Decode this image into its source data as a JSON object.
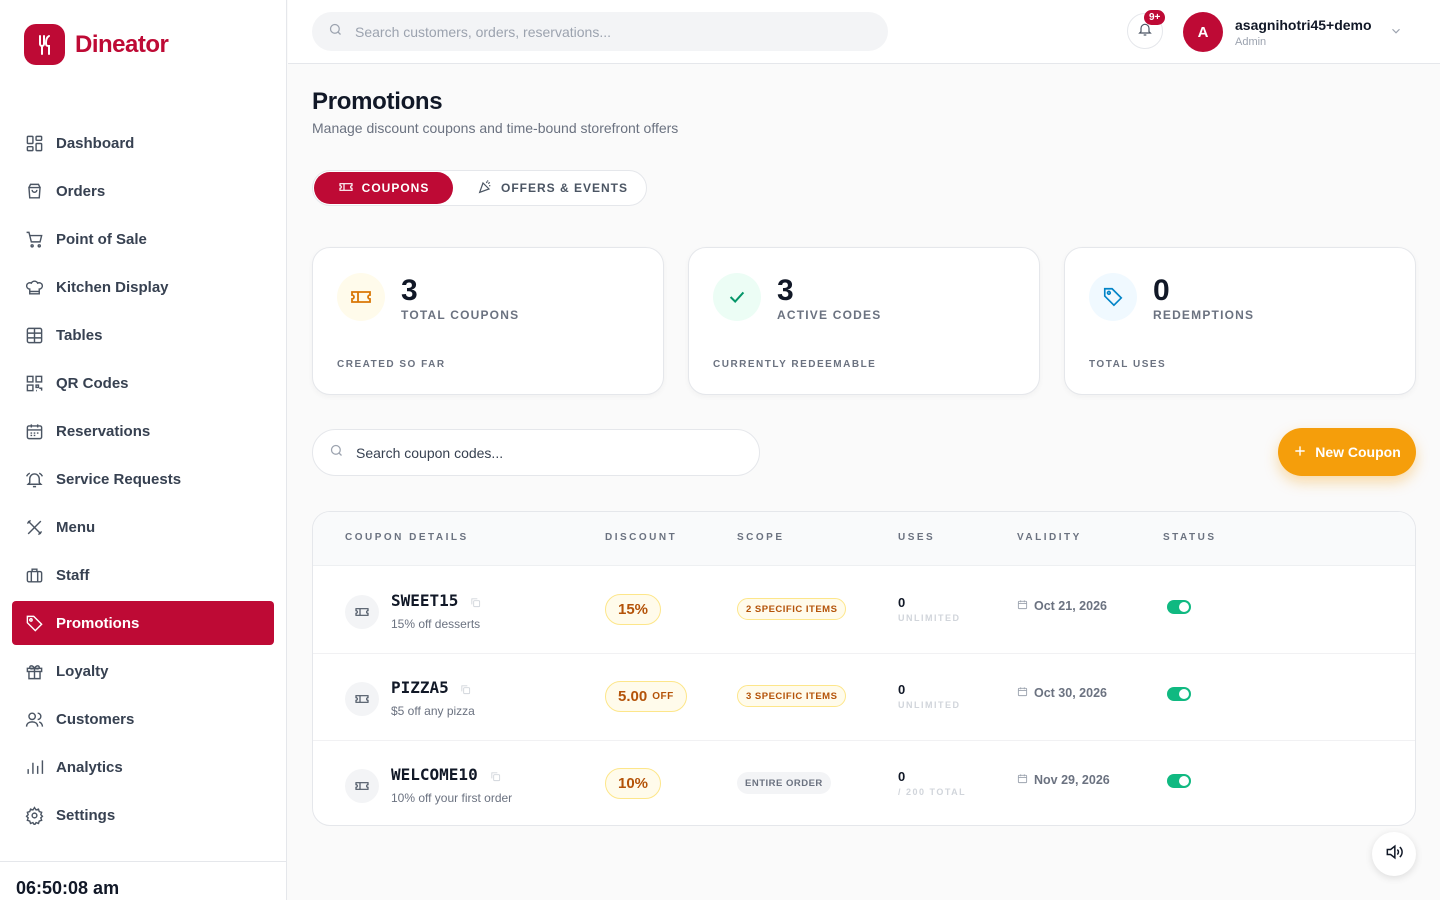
{
  "brand": {
    "name": "Dineator",
    "accent": "#be0a35",
    "orange": "#f59e0b",
    "green": "#10b981"
  },
  "sidebar": {
    "items": [
      {
        "label": "Dashboard",
        "icon": "dashboard-icon"
      },
      {
        "label": "Orders",
        "icon": "shopping-bag-icon"
      },
      {
        "label": "Point of Sale",
        "icon": "cart-icon"
      },
      {
        "label": "Kitchen Display",
        "icon": "chef-hat-icon"
      },
      {
        "label": "Tables",
        "icon": "table-grid-icon"
      },
      {
        "label": "QR Codes",
        "icon": "qr-code-icon"
      },
      {
        "label": "Reservations",
        "icon": "calendar-icon"
      },
      {
        "label": "Service Requests",
        "icon": "bell-ring-icon"
      },
      {
        "label": "Menu",
        "icon": "utensils-icon"
      },
      {
        "label": "Staff",
        "icon": "briefcase-icon"
      },
      {
        "label": "Promotions",
        "icon": "tag-icon",
        "active": true
      },
      {
        "label": "Loyalty",
        "icon": "gift-icon"
      },
      {
        "label": "Customers",
        "icon": "users-icon"
      },
      {
        "label": "Analytics",
        "icon": "bar-chart-icon"
      },
      {
        "label": "Settings",
        "icon": "gear-icon"
      }
    ],
    "clock": "06:50:08 am"
  },
  "topbar": {
    "search_placeholder": "Search customers, orders, reservations...",
    "notifications_badge": "9+",
    "user": {
      "initial": "A",
      "name": "asagnihotri45+demo",
      "role": "Admin"
    }
  },
  "page": {
    "title": "Promotions",
    "subtitle": "Manage discount coupons and time-bound storefront offers",
    "tabs": [
      {
        "label": "COUPONS",
        "active": true
      },
      {
        "label": "OFFERS & EVENTS",
        "active": false
      }
    ]
  },
  "stats": [
    {
      "value": "3",
      "label": "TOTAL COUPONS",
      "foot": "CREATED SO FAR"
    },
    {
      "value": "3",
      "label": "ACTIVE CODES",
      "foot": "CURRENTLY REDEEMABLE"
    },
    {
      "value": "0",
      "label": "REDEMPTIONS",
      "foot": "TOTAL USES"
    }
  ],
  "coupon_search_placeholder": "Search coupon codes...",
  "new_coupon_label": "New Coupon",
  "table": {
    "headers": [
      "COUPON DETAILS",
      "DISCOUNT",
      "SCOPE",
      "USES",
      "VALIDITY",
      "STATUS"
    ],
    "rows": [
      {
        "code": "SWEET15",
        "desc": "15% off desserts",
        "discount": "15%",
        "discount_suffix": "",
        "scope": "2 SPECIFIC ITEMS",
        "uses": "0",
        "uses_sub": "UNLIMITED",
        "validity": "Oct 21, 2026",
        "enabled": true
      },
      {
        "code": "PIZZA5",
        "desc": "$5 off any pizza",
        "discount": "5.00",
        "discount_suffix": "OFF",
        "scope": "3 SPECIFIC ITEMS",
        "uses": "0",
        "uses_sub": "UNLIMITED",
        "validity": "Oct 30, 2026",
        "enabled": true
      },
      {
        "code": "WELCOME10",
        "desc": "10% off your first order",
        "discount": "10%",
        "discount_suffix": "",
        "scope": "ENTIRE ORDER",
        "uses": "0",
        "uses_sub": "/ 200 TOTAL",
        "validity": "Nov 29, 2026",
        "enabled": true
      }
    ]
  }
}
